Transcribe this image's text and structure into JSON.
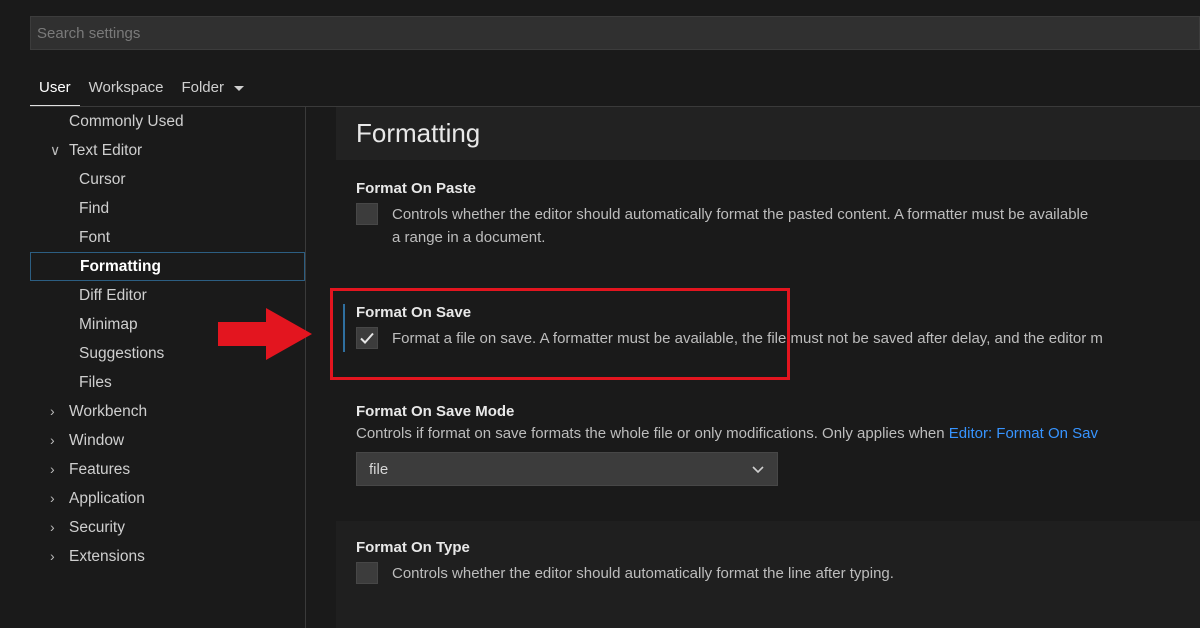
{
  "search": {
    "placeholder": "Search settings"
  },
  "scope_tabs": [
    {
      "label": "User"
    },
    {
      "label": "Workspace"
    },
    {
      "label": "Folder"
    }
  ],
  "toc": {
    "commonly_used": "Commonly Used",
    "text_editor": "Text Editor",
    "text_editor_children": [
      "Cursor",
      "Find",
      "Font",
      "Formatting",
      "Diff Editor",
      "Minimap",
      "Suggestions",
      "Files"
    ],
    "collapsed": [
      "Workbench",
      "Window",
      "Features",
      "Application",
      "Security",
      "Extensions"
    ]
  },
  "section": {
    "title": "Formatting"
  },
  "settings": {
    "format_on_paste": {
      "title": "Format On Paste",
      "description": "Controls whether the editor should automatically format the pasted content. A formatter must be available",
      "description_cont": "a range in a document.",
      "checked": false
    },
    "format_on_save": {
      "title": "Format On Save",
      "description": "Format a file on save. A formatter must be available, the file must not be saved after delay, and the editor m",
      "checked": true
    },
    "format_on_save_mode": {
      "title": "Format On Save Mode",
      "description": "Controls if format on save formats the whole file or only modifications. Only applies when",
      "link": "Editor: Format On Sav",
      "value": "file"
    },
    "format_on_type": {
      "title": "Format On Type",
      "description": "Controls whether the editor should automatically format the line after typing.",
      "checked": false
    }
  },
  "colors": {
    "background": "#1a1a1a",
    "accent_link": "#3794ff",
    "annotation_red": "#e3151f",
    "selection_border": "#2c5e82"
  }
}
